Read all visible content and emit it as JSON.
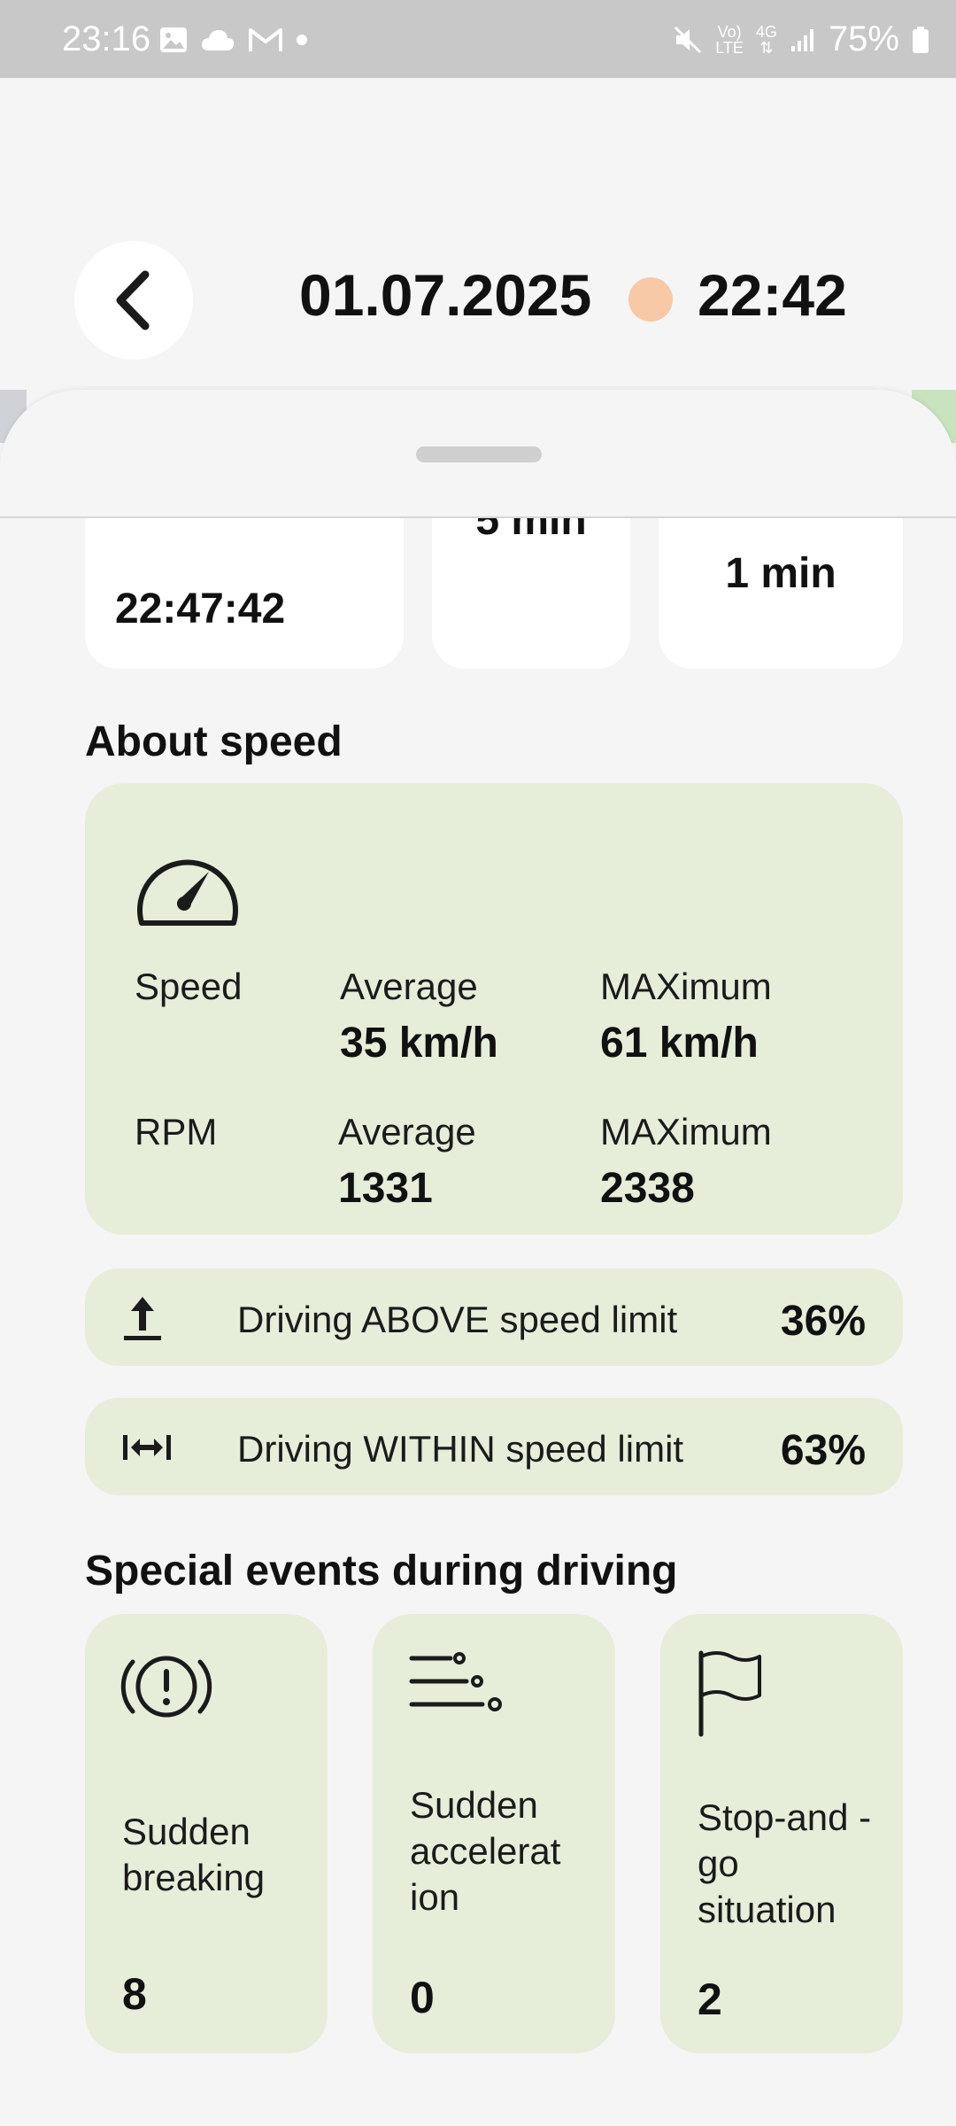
{
  "status_bar": {
    "time": "23:16",
    "network_top": "Vo)",
    "network_bottom": "LTE",
    "data_type": "4G",
    "battery": "75%",
    "left_icons": [
      "image-icon",
      "cloud-icon",
      "gmail-icon",
      "dot-icon"
    ],
    "right_icons": [
      "mute-icon",
      "volte-icon",
      "data-4g-icon",
      "signal-icon",
      "battery-icon"
    ]
  },
  "header": {
    "date": "01.07.2025",
    "time": "22:42",
    "dot_color": "#f8c9a6"
  },
  "summary_cards": {
    "end_time": "22:47:42",
    "middle_partial": "5 min",
    "right_value": "1 min"
  },
  "about_speed": {
    "title": "About speed",
    "speed_label": "Speed",
    "speed_avg_label": "Average",
    "speed_avg_value": "35 km/h",
    "speed_max_label": "MAXimum",
    "speed_max_value": "61 km/h",
    "rpm_label": "RPM",
    "rpm_avg_label": "Average",
    "rpm_avg_value": "1331",
    "rpm_max_label": "MAXimum",
    "rpm_max_value": "2338"
  },
  "speed_limits": [
    {
      "label": "Driving ABOVE speed limit",
      "percent": "36%",
      "icon": "above-limit-icon"
    },
    {
      "label": "Driving WITHIN speed limit",
      "percent": "63%",
      "icon": "within-limit-icon"
    }
  ],
  "special_events": {
    "title": "Special events during driving",
    "items": [
      {
        "label": "Sudden breaking",
        "count": "8",
        "icon": "brake-warning-icon"
      },
      {
        "label": "Sudden accelerat ion",
        "count": "0",
        "icon": "acceleration-icon"
      },
      {
        "label": "Stop-and -go situation",
        "count": "2",
        "icon": "flag-icon"
      }
    ]
  },
  "colors": {
    "card_green": "#e6eed9",
    "background": "#f5f5f5",
    "status_bar": "#c8c8c8"
  }
}
